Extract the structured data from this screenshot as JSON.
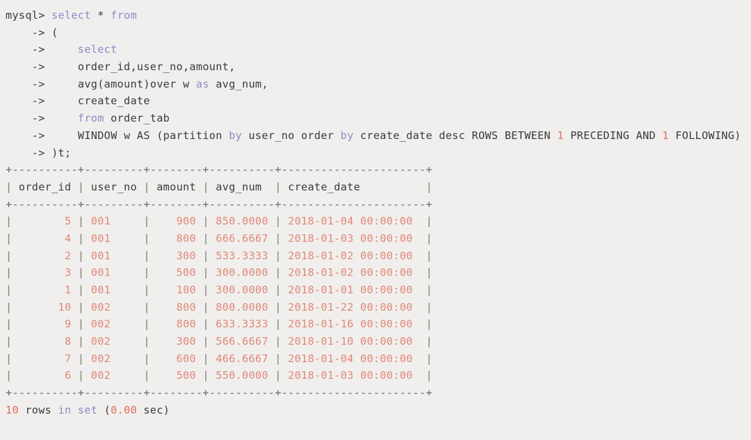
{
  "terminal": {
    "prompt": "mysql>",
    "continuation": "->",
    "query_lines": [
      {
        "indent": "",
        "prompt": "mysql>",
        "tokens": [
          {
            "t": " ",
            "c": "plain"
          },
          {
            "t": "select",
            "c": "kw"
          },
          {
            "t": " * ",
            "c": "plain"
          },
          {
            "t": "from",
            "c": "kw"
          }
        ]
      },
      {
        "indent": "    ",
        "prompt": "->",
        "tokens": [
          {
            "t": " (",
            "c": "plain"
          }
        ]
      },
      {
        "indent": "    ",
        "prompt": "->",
        "tokens": [
          {
            "t": "     ",
            "c": "plain"
          },
          {
            "t": "select",
            "c": "kw"
          }
        ]
      },
      {
        "indent": "    ",
        "prompt": "->",
        "tokens": [
          {
            "t": "     order_id,user_no,amount,",
            "c": "plain"
          }
        ]
      },
      {
        "indent": "    ",
        "prompt": "->",
        "tokens": [
          {
            "t": "     avg(amount)over w ",
            "c": "plain"
          },
          {
            "t": "as",
            "c": "kw"
          },
          {
            "t": " avg_num,",
            "c": "plain"
          }
        ]
      },
      {
        "indent": "    ",
        "prompt": "->",
        "tokens": [
          {
            "t": "     create_date",
            "c": "plain"
          }
        ]
      },
      {
        "indent": "    ",
        "prompt": "->",
        "tokens": [
          {
            "t": "     ",
            "c": "plain"
          },
          {
            "t": "from",
            "c": "kw"
          },
          {
            "t": " order_tab",
            "c": "plain"
          }
        ]
      },
      {
        "indent": "    ",
        "prompt": "->",
        "tokens": [
          {
            "t": "     WINDOW w AS (partition ",
            "c": "plain"
          },
          {
            "t": "by",
            "c": "kw"
          },
          {
            "t": " user_no order ",
            "c": "plain"
          },
          {
            "t": "by",
            "c": "kw"
          },
          {
            "t": " create_date desc ROWS BETWEEN ",
            "c": "plain"
          },
          {
            "t": "1",
            "c": "num"
          },
          {
            "t": " PRECEDING AND ",
            "c": "plain"
          },
          {
            "t": "1",
            "c": "num"
          },
          {
            "t": " FOLLOWING)",
            "c": "plain"
          }
        ]
      },
      {
        "indent": "    ",
        "prompt": "->",
        "tokens": [
          {
            "t": " )t;",
            "c": "plain"
          }
        ]
      }
    ],
    "result_table": {
      "separator": "+----------+---------+--------+----------+----------------------+",
      "columns": [
        {
          "label": "order_id",
          "width": 10,
          "align": "right"
        },
        {
          "label": "user_no",
          "width": 9,
          "align": "left"
        },
        {
          "label": "amount",
          "width": 8,
          "align": "right"
        },
        {
          "label": "avg_num",
          "width": 10,
          "align": "right"
        },
        {
          "label": "create_date",
          "width": 22,
          "align": "left"
        }
      ],
      "rows": [
        [
          "5",
          "001",
          "900",
          "850.0000",
          "2018-01-04 00:00:00"
        ],
        [
          "4",
          "001",
          "800",
          "666.6667",
          "2018-01-03 00:00:00"
        ],
        [
          "2",
          "001",
          "300",
          "533.3333",
          "2018-01-02 00:00:00"
        ],
        [
          "3",
          "001",
          "500",
          "300.0000",
          "2018-01-02 00:00:00"
        ],
        [
          "1",
          "001",
          "100",
          "300.0000",
          "2018-01-01 00:00:00"
        ],
        [
          "10",
          "002",
          "800",
          "800.0000",
          "2018-01-22 00:00:00"
        ],
        [
          "9",
          "002",
          "800",
          "633.3333",
          "2018-01-16 00:00:00"
        ],
        [
          "8",
          "002",
          "300",
          "566.6667",
          "2018-01-10 00:00:00"
        ],
        [
          "7",
          "002",
          "600",
          "466.6667",
          "2018-01-04 00:00:00"
        ],
        [
          "6",
          "002",
          "500",
          "550.0000",
          "2018-01-03 00:00:00"
        ]
      ]
    },
    "footer": [
      {
        "t": "10",
        "c": "num"
      },
      {
        "t": " rows ",
        "c": "plain"
      },
      {
        "t": "in set",
        "c": "kw"
      },
      {
        "t": " (",
        "c": "plain"
      },
      {
        "t": "0.00",
        "c": "num"
      },
      {
        "t": " sec)",
        "c": "plain"
      }
    ]
  },
  "colors": {
    "background": "#f0efed",
    "text": "#3a3a3a",
    "keyword": "#8b8bc8",
    "number": "#e06c5a",
    "value": "#e08878",
    "rule": "#6a6a6a"
  }
}
